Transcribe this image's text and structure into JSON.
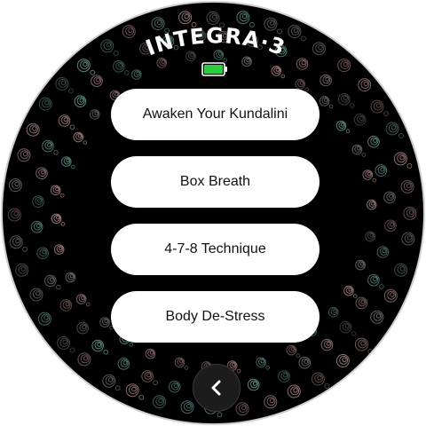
{
  "app": {
    "brand": "INTEGRA",
    "brand_dot": "·",
    "brand_number": "3",
    "battery": {
      "level": 1.0,
      "color": "#2ecc40"
    }
  },
  "menu": {
    "items": [
      {
        "label": "Awaken Your Kundalini"
      },
      {
        "label": "Box Breath"
      },
      {
        "label": "4-7-8 Technique"
      },
      {
        "label": "Body De-Stress"
      }
    ]
  },
  "nav": {
    "back_icon": "chevron-left-icon"
  },
  "colors": {
    "background": "#000000",
    "button": "#ffffff",
    "button_text": "#111111",
    "pattern_pink": "#e8b4b8",
    "pattern_teal": "#8fd3c7",
    "pattern_gray": "#9a9a9a"
  }
}
